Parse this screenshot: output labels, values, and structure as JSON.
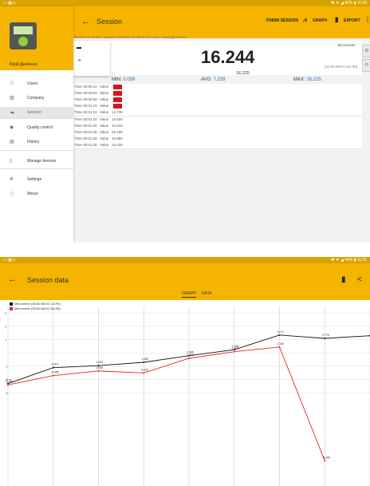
{
  "screen1": {
    "status_bar": {
      "left": "▭ ▦ ▷",
      "right": "✱ ▼ ◢ 40% ▮ 11:00"
    },
    "app_bar": {
      "title": "Session",
      "finish_label": "FINISH SESSION",
      "graph_label": "GRAPH",
      "export_label": "EXPORT"
    },
    "drawer": {
      "user_name": "Юрій Дьяченко",
      "items": [
        {
          "label": "Users",
          "icon": "person-icon"
        },
        {
          "label": "Company",
          "icon": "building-icon"
        },
        {
          "label": "Session",
          "icon": "cloud-icon"
        },
        {
          "label": "Quality control",
          "icon": "eye-icon"
        },
        {
          "label": "History",
          "icon": "calendar-icon"
        },
        {
          "label": "Manage devices",
          "icon": "phone-icon"
        },
        {
          "label": "Settings",
          "icon": "gear-icon"
        },
        {
          "label": "About",
          "icon": "info-icon"
        }
      ]
    },
    "session_info": "Session is active. Started: 2018-08-10 08:42:10. User: Юрій Дьяченко.",
    "device_label": "Micrometer",
    "reading": "16.244",
    "device_mac": "[00:80:98:DC:8A:98]",
    "last_value": "16.225",
    "stats": {
      "min": "0.059",
      "avg": "7.239",
      "max": "16.225"
    },
    "rows": [
      {
        "time": "00:00:12",
        "value": "0.059",
        "flag": true
      },
      {
        "time": "00:00:54",
        "value": "0.114",
        "flag": true
      },
      {
        "time": "00:00:59",
        "value": "0.213",
        "flag": true
      },
      {
        "time": "00:01:16",
        "value": "0.319",
        "flag": true
      },
      {
        "time": "00:01:22",
        "value": "12.736",
        "flag": false
      },
      {
        "time": "00:01:24",
        "value": "14.025",
        "flag": false
      },
      {
        "time": "00:01:25",
        "value": "14.214",
        "flag": false
      },
      {
        "time": "00:01:26",
        "value": "15.266",
        "flag": false
      },
      {
        "time": "00:01:28",
        "value": "15.885",
        "flag": false
      },
      {
        "time": "00:01:30",
        "value": "16.225",
        "flag": false
      }
    ]
  },
  "screen2": {
    "status_bar": {
      "left": "▭ ▦ ▷",
      "right": "✱ ▼ ◢ 44% ▮ 11:01"
    },
    "app_bar": {
      "title": "Session data",
      "tabs": [
        "GRAPH",
        "DATA"
      ]
    },
    "chart_data": {
      "type": "line",
      "ylim": [
        -10,
        3.5
      ],
      "grid": true,
      "legend": "top-left",
      "x": [
        0,
        1,
        2,
        3,
        4,
        5,
        6,
        7,
        8
      ],
      "series": [
        {
          "name": "Micrometer (00:80:98:DC:18:F0)",
          "color": "#111111",
          "values": [
            -2.3,
            -1.1,
            -0.95,
            -0.7,
            -0.2,
            0.25,
            1.35,
            1.1,
            1.3
          ],
          "labels": [
            "-2.31",
            "-0.872",
            "1.063",
            "1.280",
            "1.565",
            "2.055",
            "3.071",
            "2.775",
            ""
          ]
        },
        {
          "name": "Micrometer (00:80:98:DC:8A:98)",
          "color": "#e8202a",
          "values": [
            -2.4,
            -1.7,
            -1.35,
            -1.5,
            -0.4,
            0.1,
            0.45,
            -8.1,
            null
          ],
          "labels": [
            "-2.433",
            "-0.455",
            "0.809",
            "0.633",
            "1.490",
            "1.803",
            "2.190",
            "-8.189",
            ""
          ]
        }
      ],
      "ytick_labels": [
        "3",
        "2",
        "1",
        "",
        "-1",
        "-2",
        "-3"
      ]
    }
  }
}
